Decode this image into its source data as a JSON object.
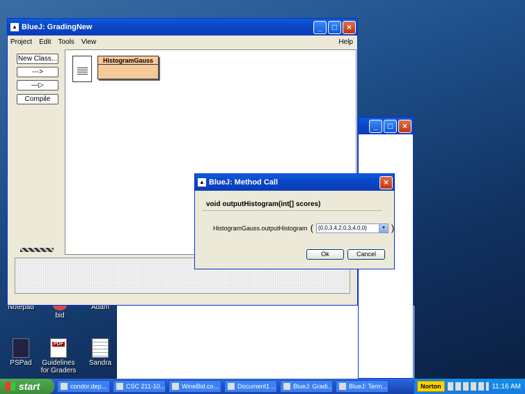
{
  "desktop": {
    "icons_bottom": [
      {
        "label": "Notepad"
      },
      {
        "label": "bid"
      },
      {
        "label": "Adam"
      },
      {
        "label": "PSPad"
      },
      {
        "label": "Guidelines for Graders"
      },
      {
        "label": "Sandra"
      }
    ]
  },
  "main_window": {
    "title": "BlueJ:  GradingNew",
    "menu": [
      "Project",
      "Edit",
      "Tools",
      "View"
    ],
    "help": "Help",
    "buttons": {
      "new_class": "New Class...",
      "dependency": "--->",
      "inherit": "—▷",
      "compile": "Compile"
    },
    "class_name": "HistogramGauss"
  },
  "dialog": {
    "title": "BlueJ:  Method Call",
    "signature": "void outputHistogram(int[] scores)",
    "call_prefix": "HistogramGauss.outputHistogram",
    "open_paren": "(",
    "close_paren": ")",
    "argument_value": "{0,0,3,4,2,0,3,4,0,0}",
    "ok": "Ok",
    "cancel": "Cancel"
  },
  "taskbar": {
    "start": "start",
    "items": [
      "condor.dep...",
      "CSC 211-10...",
      "WineBid.co...",
      "Document1 ...",
      "BlueJ: Gradi...",
      "BlueJ: Term..."
    ],
    "norton": "Norton",
    "clock": "11:16 AM"
  }
}
